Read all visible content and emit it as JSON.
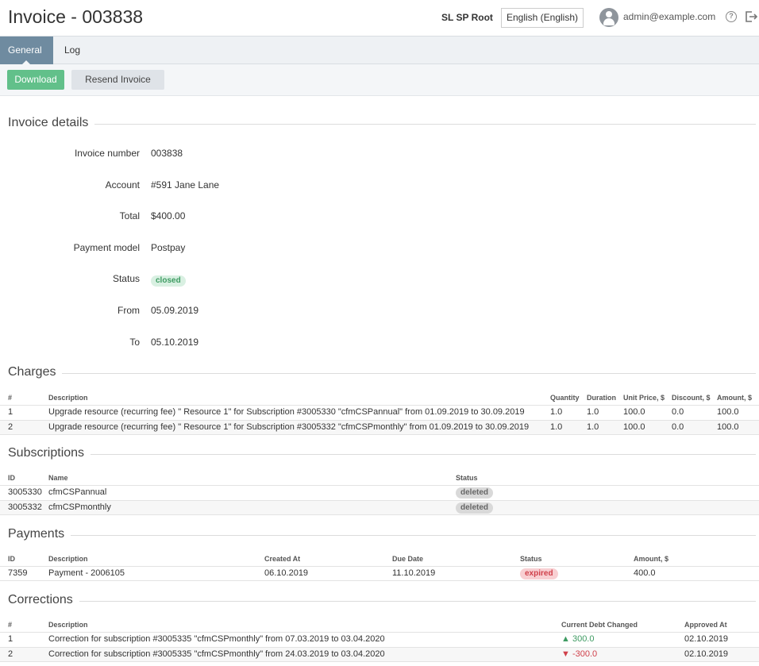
{
  "header": {
    "title": "Invoice - 003838",
    "org": "SL SP Root",
    "language": "English (English)",
    "user_email": "admin@example.com",
    "help_glyph": "?"
  },
  "tabs": [
    {
      "label": "General",
      "active": true
    },
    {
      "label": "Log",
      "active": false
    }
  ],
  "toolbar": {
    "download_label": "Download",
    "resend_label": "Resend Invoice"
  },
  "invoice_details": {
    "title": "Invoice details",
    "fields": [
      {
        "label": "Invoice number",
        "value": "003838"
      },
      {
        "label": "Account",
        "value": "#591 Jane Lane"
      },
      {
        "label": "Total",
        "value": "$400.00"
      },
      {
        "label": "Payment model",
        "value": "Postpay"
      },
      {
        "label": "Status",
        "value": "closed"
      },
      {
        "label": "From",
        "value": "05.09.2019"
      },
      {
        "label": "To",
        "value": "05.10.2019"
      }
    ]
  },
  "charges": {
    "title": "Charges",
    "columns": [
      "#",
      "Description",
      "Quantity",
      "Duration",
      "Unit Price, $",
      "Discount, $",
      "Amount, $"
    ],
    "rows": [
      {
        "num": "1",
        "description": "Upgrade resource (recurring fee) \" Resource 1\" for Subscription #3005330 \"cfmCSPannual\" from 01.09.2019 to 30.09.2019",
        "quantity": "1.0",
        "duration": "1.0",
        "unit_price": "100.0",
        "discount": "0.0",
        "amount": "100.0"
      },
      {
        "num": "2",
        "description": "Upgrade resource (recurring fee) \" Resource 1\" for Subscription #3005332 \"cfmCSPmonthly\" from 01.09.2019 to 30.09.2019",
        "quantity": "1.0",
        "duration": "1.0",
        "unit_price": "100.0",
        "discount": "0.0",
        "amount": "100.0"
      }
    ]
  },
  "subscriptions": {
    "title": "Subscriptions",
    "columns": [
      "ID",
      "Name",
      "Status"
    ],
    "rows": [
      {
        "id": "3005330",
        "name": "cfmCSPannual",
        "status": "deleted"
      },
      {
        "id": "3005332",
        "name": "cfmCSPmonthly",
        "status": "deleted"
      }
    ]
  },
  "payments": {
    "title": "Payments",
    "columns": [
      "ID",
      "Description",
      "Created At",
      "Due Date",
      "Status",
      "Amount, $"
    ],
    "rows": [
      {
        "id": "7359",
        "description": "Payment - 2006105",
        "created_at": "06.10.2019",
        "due_date": "11.10.2019",
        "status": "expired",
        "amount": "400.0"
      }
    ]
  },
  "corrections": {
    "title": "Corrections",
    "columns": [
      "#",
      "Description",
      "Current Debt Changed",
      "Approved At"
    ],
    "rows": [
      {
        "num": "1",
        "description": "Correction for subscription #3005335 \"cfmCSPmonthly\" from 07.03.2019 to 03.04.2020",
        "arrow": "▲",
        "debt_changed": "300.0",
        "approved_at": "02.10.2019"
      },
      {
        "num": "2",
        "description": "Correction for subscription #3005335 \"cfmCSPmonthly\" from 24.03.2019 to 03.04.2020",
        "arrow": "▼",
        "debt_changed": "-300.0",
        "approved_at": "02.10.2019"
      }
    ]
  },
  "colors": {
    "tab_active": "#6f8ba0",
    "download_button": "#62c08a",
    "link": "#3a8bc8",
    "positive": "#3e9b62",
    "negative": "#d0414b"
  }
}
